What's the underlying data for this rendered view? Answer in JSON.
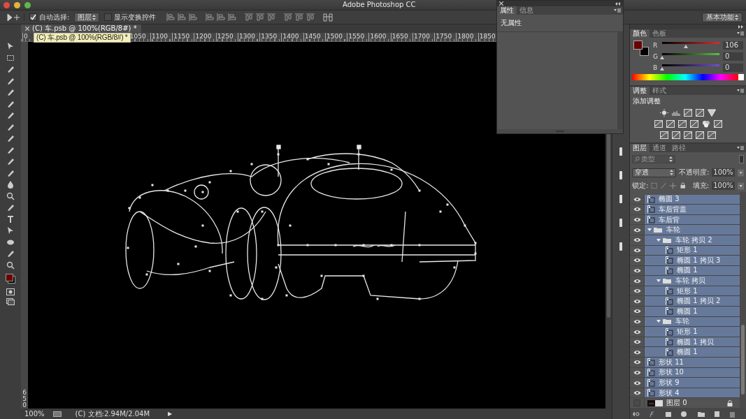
{
  "window": {
    "title": "Adobe Photoshop CC"
  },
  "options_bar": {
    "auto_select": {
      "label": "自动选择:",
      "checked": true
    },
    "auto_select_target": "图层",
    "show_transform": {
      "label": "显示变换控件",
      "checked": false
    },
    "workspace": "基本功能"
  },
  "document": {
    "tab": {
      "title": "(C) 车.psb @ 100%(RGB/8#) *",
      "selected": true
    },
    "tooltip": "(C) 车.psb @ 100%(RGB/8#) *",
    "ruler_labels": [
      "0",
      "1050",
      "1100",
      "1150",
      "1200",
      "1250",
      "1300",
      "1350",
      "1400",
      "1450",
      "1500",
      "1550",
      "1600",
      "1650",
      "1700",
      "1750",
      "1800",
      "1850"
    ],
    "vertical_ruler_labels": [
      "650"
    ]
  },
  "status_bar": {
    "zoom": "100%",
    "doc_info": "(C) 文档:2.94M/2.04M",
    "menu_arrow": "▶"
  },
  "properties_panel": {
    "tabs": [
      {
        "label": "属性",
        "selected": true
      },
      {
        "label": "信息",
        "selected": false
      }
    ],
    "message": "无属性"
  },
  "color_panel": {
    "tabs": [
      {
        "label": "颜色",
        "selected": true
      },
      {
        "label": "色板",
        "selected": false
      }
    ],
    "channels": [
      {
        "name": "R",
        "level": 0.416,
        "value": "106"
      },
      {
        "name": "G",
        "level": 0,
        "value": "0"
      },
      {
        "name": "B",
        "level": 0,
        "value": "0"
      }
    ]
  },
  "adjustments_panel": {
    "tabs": [
      {
        "label": "调整",
        "selected": true
      },
      {
        "label": "样式",
        "selected": false
      }
    ],
    "heading": "添加调整"
  },
  "layers_panel": {
    "tabs": [
      {
        "label": "图层",
        "selected": true
      },
      {
        "label": "通道",
        "selected": false
      },
      {
        "label": "路径",
        "selected": false
      }
    ],
    "filter": "类型",
    "blend_mode": "穿透",
    "opacity_label": "不透明度:",
    "opacity": "100%",
    "lock_label": "锁定:",
    "fill_label": "填充:",
    "fill": "100%",
    "layers": [
      {
        "name": "椭圆 3",
        "kind": "shape",
        "visible": true,
        "selected": true,
        "locked": false
      },
      {
        "name": "车后背盖",
        "kind": "shape",
        "visible": true,
        "selected": true,
        "locked": false
      },
      {
        "name": "车后背",
        "kind": "shape",
        "visible": true,
        "selected": true,
        "locked": false
      },
      {
        "name": "车轮",
        "kind": "group",
        "visible": true,
        "selected": true,
        "locked": false,
        "expanded": true,
        "children": [
          {
            "name": "车轮 拷贝 2",
            "kind": "group",
            "visible": true,
            "selected": true,
            "locked": false,
            "expanded": true,
            "children": [
              {
                "name": "矩形 1",
                "kind": "shape",
                "visible": true,
                "selected": true,
                "locked": false
              },
              {
                "name": "椭圆 1 拷贝 3",
                "kind": "shape",
                "visible": true,
                "selected": true,
                "locked": false
              },
              {
                "name": "椭圆 1",
                "kind": "shape",
                "visible": true,
                "selected": true,
                "locked": false
              }
            ]
          },
          {
            "name": "车轮 拷贝",
            "kind": "group",
            "visible": true,
            "selected": true,
            "locked": false,
            "expanded": true,
            "children": [
              {
                "name": "矩形 1",
                "kind": "shape",
                "visible": true,
                "selected": true,
                "locked": false
              },
              {
                "name": "椭圆 1 拷贝 2",
                "kind": "shape",
                "visible": true,
                "selected": true,
                "locked": false
              },
              {
                "name": "椭圆 1",
                "kind": "shape",
                "visible": true,
                "selected": true,
                "locked": false
              }
            ]
          },
          {
            "name": "车轮",
            "kind": "group",
            "visible": true,
            "selected": true,
            "locked": false,
            "expanded": true,
            "children": [
              {
                "name": "矩形 1",
                "kind": "shape",
                "visible": true,
                "selected": true,
                "locked": false
              },
              {
                "name": "椭圆 1 拷贝",
                "kind": "shape",
                "visible": true,
                "selected": true,
                "locked": false
              },
              {
                "name": "椭圆 1",
                "kind": "shape",
                "visible": true,
                "selected": true,
                "locked": false
              }
            ]
          }
        ]
      },
      {
        "name": "形状 11",
        "kind": "shape",
        "visible": true,
        "selected": true,
        "locked": false
      },
      {
        "name": "形状 10",
        "kind": "shape",
        "visible": true,
        "selected": true,
        "locked": false
      },
      {
        "name": "形状 9",
        "kind": "shape",
        "visible": true,
        "selected": true,
        "locked": false
      },
      {
        "name": "形状 4",
        "kind": "shape",
        "visible": true,
        "selected": true,
        "locked": false
      },
      {
        "name": "图层 0",
        "kind": "pixel",
        "visible": false,
        "selected": false,
        "locked": true
      }
    ]
  }
}
